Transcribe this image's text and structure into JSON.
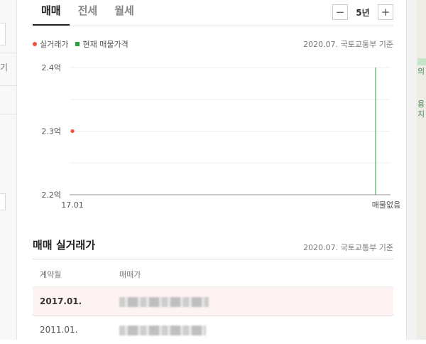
{
  "tabs": [
    {
      "label": "매매",
      "active": true
    },
    {
      "label": "전세",
      "active": false
    },
    {
      "label": "월세",
      "active": false
    }
  ],
  "period": {
    "minus": "−",
    "label": "5년",
    "plus": "+"
  },
  "legend": {
    "actual": "실거래가",
    "listing": "현재 매물가격"
  },
  "source": "2020.07. 국토교통부 기준",
  "chart_data": {
    "type": "scatter",
    "y_ticks": [
      "2.4억",
      "2.3억",
      "2.2억"
    ],
    "x_ticks": [
      "17.01",
      "매물없음"
    ],
    "ylim": [
      2.2,
      2.4
    ],
    "series": [
      {
        "name": "실거래가",
        "color": "#f0533a",
        "points": [
          {
            "x": "17.01",
            "y": 2.3
          }
        ]
      },
      {
        "name": "현재 매물가격",
        "color": "#2e9e46",
        "points": [
          {
            "x": "매물없음",
            "y": null
          }
        ]
      }
    ]
  },
  "transactions": {
    "title": "매매 실거래가",
    "source": "2020.07. 국토교통부 기준",
    "headers": [
      "계약월",
      "매매가"
    ],
    "rows": [
      {
        "date": "2017.01.",
        "highlight": true
      },
      {
        "date": "2011.01.",
        "highlight": false
      }
    ]
  },
  "side": {
    "left_glyph": "기",
    "map_labels": [
      "의",
      "용",
      "치"
    ]
  }
}
